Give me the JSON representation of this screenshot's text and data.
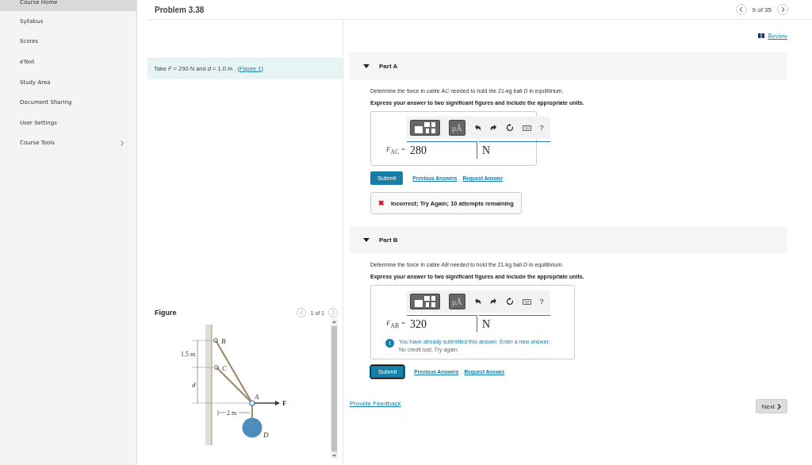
{
  "sidebar": {
    "items": [
      {
        "label": "Course Home",
        "selected": true,
        "has_submenu": false
      },
      {
        "label": "Syllabus",
        "selected": false,
        "has_submenu": false
      },
      {
        "label": "Scores",
        "selected": false,
        "has_submenu": false
      },
      {
        "label": "eText",
        "selected": false,
        "has_submenu": false
      },
      {
        "label": "Study Area",
        "selected": false,
        "has_submenu": false
      },
      {
        "label": "Document Sharing",
        "selected": false,
        "has_submenu": false
      },
      {
        "label": "User Settings",
        "selected": false,
        "has_submenu": false
      },
      {
        "label": "Course Tools",
        "selected": false,
        "has_submenu": true
      }
    ]
  },
  "header": {
    "title": "Problem 3.38",
    "counter": "9 of 35"
  },
  "statement": {
    "before": "Take *F* = 290 N and *d* = 1.0 m . (",
    "link": "Figure 1",
    "after": ")"
  },
  "figure": {
    "title": "Figure",
    "counter": "1 of 1",
    "labels": {
      "b": "B",
      "c": "C",
      "a": "A",
      "d": "D",
      "f": "F",
      "span": "1.5 m",
      "depth": "d",
      "reach": "2 m"
    }
  },
  "review": "Review",
  "parts": [
    {
      "title": "Part A",
      "expanded": true,
      "question": "Determine the force in cable *AC* needed to hold the 21-kg ball *D* in equilibrium.",
      "instruction": "Express your answer to two significant figures and include the appropriate units.",
      "units_button": "μÅ",
      "help": "?",
      "variable": "*F*$_{AC}$",
      "equals": "=",
      "value": "280",
      "unit": "N",
      "submit": "Submit",
      "submit_focused": false,
      "links": [
        "Previous Answers",
        "Request Answer"
      ],
      "feedback": {
        "kind": "incorrect",
        "icon": "✖",
        "text": "Incorrect; Try Again; 10 attempts remaining"
      }
    },
    {
      "title": "Part B",
      "expanded": true,
      "question": "Determine the force in cable *AB* needed to hold the 21-kg ball *D* in equilibrium.",
      "instruction": "Express your answer to two significant figures and include the appropriate units.",
      "units_button": "μÅ",
      "help": "?",
      "variable": "*F*$_{AB}$",
      "equals": "=",
      "value": "320",
      "unit": "N",
      "submit": "Submit",
      "submit_focused": true,
      "links": [
        "Previous Answers",
        "Request Answer"
      ],
      "feedback": {
        "kind": "notice",
        "icon": "!",
        "text": "You have already submitted this answer. Enter a new answer.",
        "subtext": "No credit lost. Try again."
      }
    }
  ],
  "footer": {
    "feedback_link": "Provide Feedback",
    "next": "Next"
  }
}
